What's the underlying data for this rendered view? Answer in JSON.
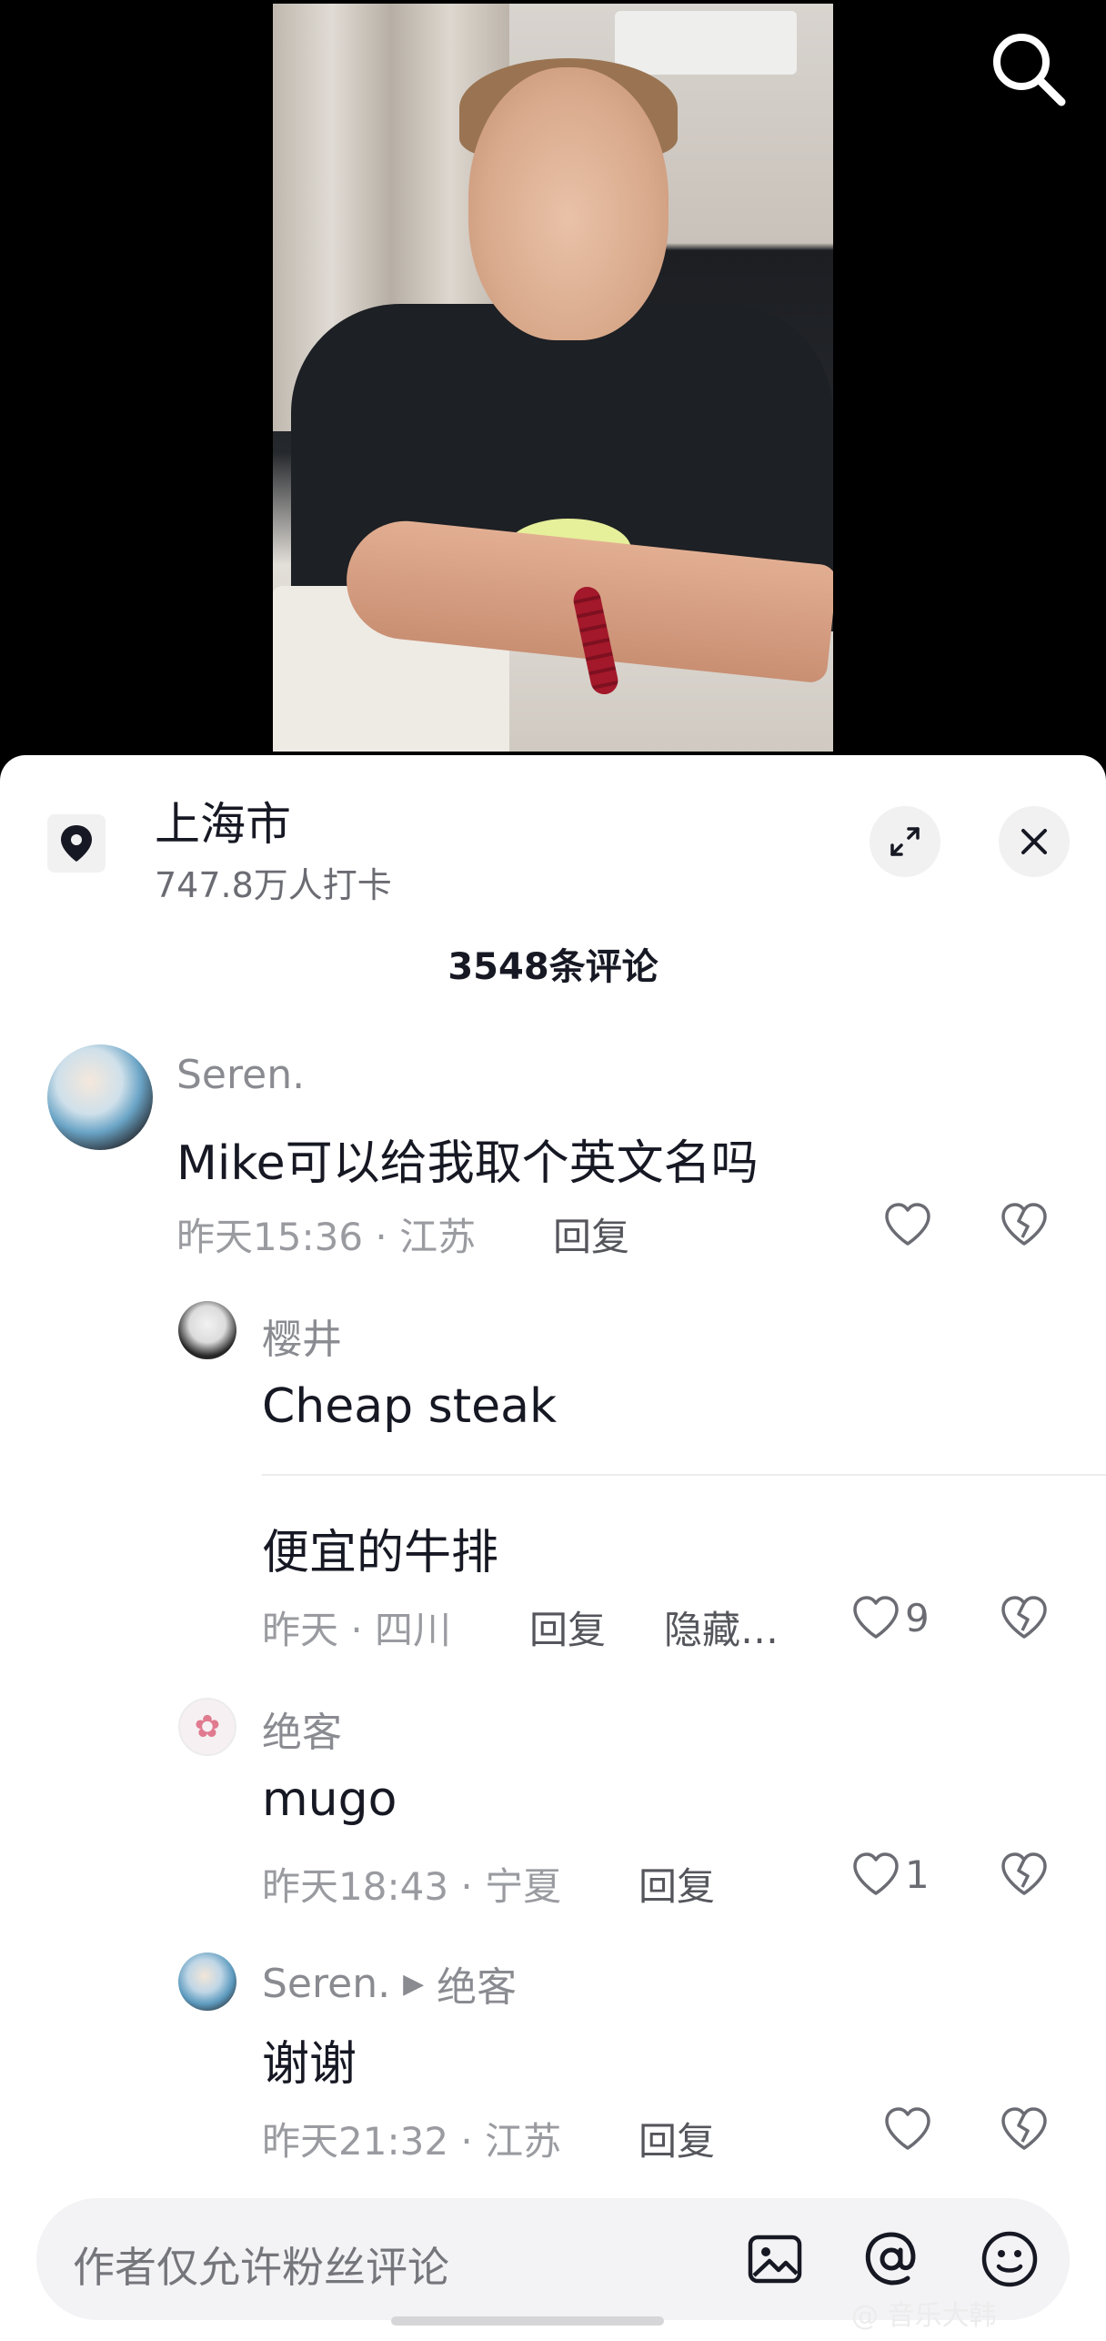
{
  "location": {
    "title": "上海市",
    "subtitle": "747.8万人打卡"
  },
  "comments_header": "3548条评论",
  "comments": [
    {
      "name": "Seren.",
      "text": "Mike可以给我取个英文名吗",
      "meta": "昨天15:36 · 江苏",
      "reply_label": "回复"
    }
  ],
  "replies": [
    {
      "name": "樱井",
      "text": "Cheap steak",
      "text2": "便宜的牛排",
      "meta": "昨天 · 四川",
      "reply_label": "回复",
      "hide_label": "隐藏…",
      "likes": "9"
    },
    {
      "name": "绝客",
      "text": "mugo",
      "meta": "昨天18:43 · 宁夏",
      "reply_label": "回复",
      "likes": "1"
    },
    {
      "name": "Seren.",
      "reply_to": "绝客",
      "text": "谢谢",
      "meta": "昨天21:32 · 江苏",
      "reply_label": "回复"
    }
  ],
  "input": {
    "placeholder": "作者仅允许粉丝评论"
  },
  "watermark": "@ 音乐大韩"
}
